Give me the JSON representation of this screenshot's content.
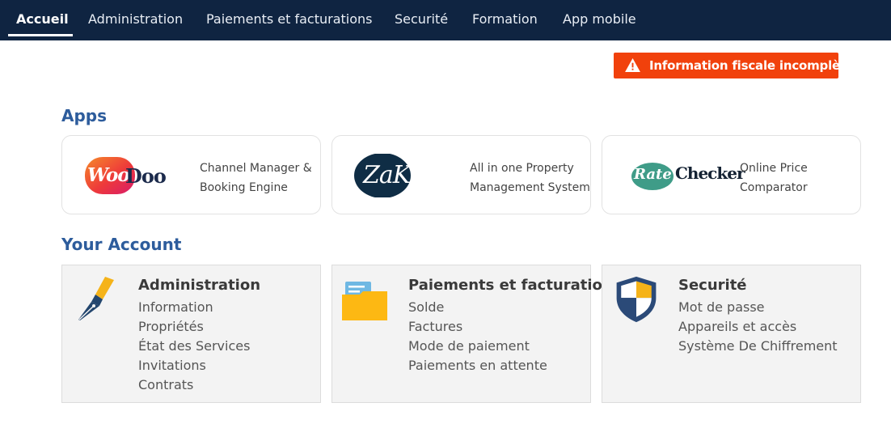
{
  "nav": {
    "items": [
      {
        "label": "Accueil",
        "active": true
      },
      {
        "label": "Administration"
      },
      {
        "label": "Paiements et facturations"
      },
      {
        "label": "Securité"
      },
      {
        "label": "Formation"
      },
      {
        "label": "App mobile"
      }
    ],
    "bg_color": "#0f2441"
  },
  "alert": {
    "text": "Information fiscale incomplète",
    "color": "#f1410c",
    "icon": "warning-icon"
  },
  "apps": {
    "title": "Apps",
    "items": [
      {
        "logo": "WooDoo",
        "logo_parts": [
          "Woo",
          "Doo"
        ],
        "desc_line1": "Channel Manager &",
        "desc_line2": "Booking Engine"
      },
      {
        "logo": "ZaK",
        "desc_line1": "All in one Property",
        "desc_line2": "Management System"
      },
      {
        "logo": "RateChecker",
        "logo_parts": [
          "Rate",
          "Checker"
        ],
        "desc_line1": "Online Price",
        "desc_line2": "Comparator"
      }
    ]
  },
  "account": {
    "title": "Your Account",
    "cards": [
      {
        "title": "Administration",
        "icon": "fountain-pen-icon",
        "links": [
          "Information",
          "Propriétés",
          "État des Services",
          "Invitations",
          "Contrats"
        ]
      },
      {
        "title": "Paiements et facturations",
        "icon": "folder-icon",
        "links": [
          "Solde",
          "Factures",
          "Mode de paiement",
          "Paiements en attente"
        ]
      },
      {
        "title": "Securité",
        "icon": "shield-icon",
        "links": [
          "Mot de passe",
          "Appareils et accès",
          "Système De Chiffrement"
        ]
      }
    ]
  }
}
